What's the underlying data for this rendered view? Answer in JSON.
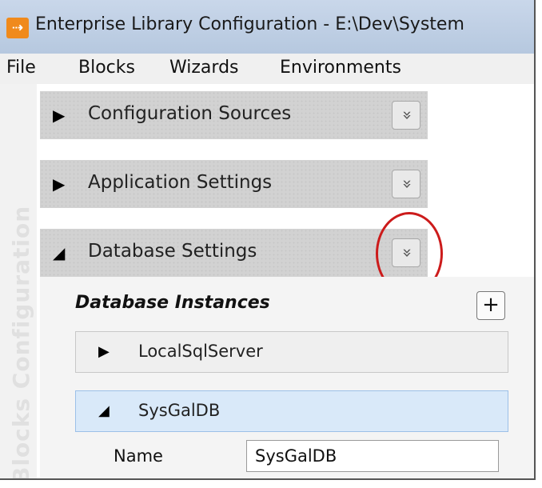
{
  "window": {
    "app_icon_glyph": "⇢",
    "title": "Enterprise Library Configuration - E:\\Dev\\System"
  },
  "menu": {
    "items": [
      "File",
      "Blocks",
      "Wizards",
      "Environments"
    ]
  },
  "sidebar": {
    "label": "Blocks Configuration"
  },
  "sections": [
    {
      "label": "Configuration Sources",
      "arrow": "▶",
      "expanded": false
    },
    {
      "label": "Application Settings",
      "arrow": "▶",
      "expanded": false
    },
    {
      "label": "Database Settings",
      "arrow": "◢",
      "expanded": true
    }
  ],
  "collapse_glyph": "»",
  "database": {
    "heading": "Database Instances",
    "add_glyph": "+",
    "instances": [
      {
        "label": "LocalSqlServer",
        "arrow": "▶",
        "expanded": false
      },
      {
        "label": "SysGalDB",
        "arrow": "◢",
        "expanded": true
      }
    ],
    "properties": {
      "name_label": "Name",
      "name_value": "SysGalDB"
    }
  },
  "colors": {
    "highlight_ring": "#cc1b1b",
    "selected_row": "#d9e9f9",
    "section_header": "#d2d2d2"
  }
}
